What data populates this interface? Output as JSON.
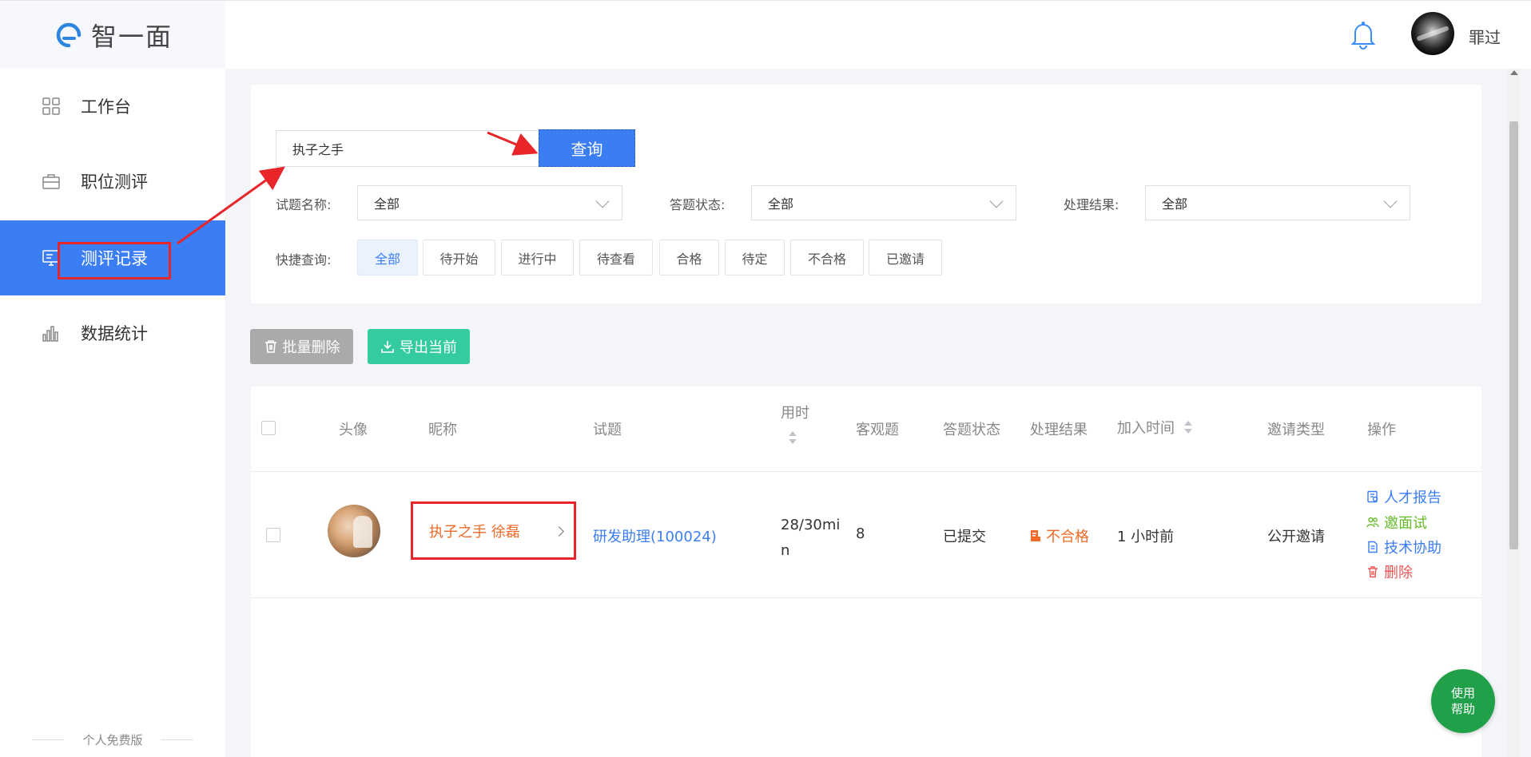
{
  "app": {
    "logo_text": "智一面",
    "username": "罪过"
  },
  "sidebar": {
    "items": [
      {
        "label": "工作台",
        "icon": "grid-icon"
      },
      {
        "label": "职位测评",
        "icon": "briefcase-icon"
      },
      {
        "label": "测评记录",
        "icon": "monitor-icon",
        "active": true
      },
      {
        "label": "数据统计",
        "icon": "bar-chart-icon"
      }
    ],
    "footer": "个人免费版"
  },
  "search": {
    "value": "执子之手",
    "button_label": "查询"
  },
  "filters": {
    "exam_name_label": "试题名称:",
    "exam_name_value": "全部",
    "answer_status_label": "答题状态:",
    "answer_status_value": "全部",
    "result_label": "处理结果:",
    "result_value": "全部",
    "quick_label": "快捷查询:",
    "quick_options": [
      "全部",
      "待开始",
      "进行中",
      "待查看",
      "合格",
      "待定",
      "不合格",
      "已邀请"
    ]
  },
  "actions": {
    "batch_delete": "批量删除",
    "export_current": "导出当前"
  },
  "table": {
    "headers": {
      "avatar": "头像",
      "nickname": "昵称",
      "exam": "试题",
      "duration": "用时",
      "objective": "客观题",
      "answer_status": "答题状态",
      "result": "处理结果",
      "join_time": "加入时间",
      "invite_type": "邀请类型",
      "operations": "操作"
    },
    "rows": [
      {
        "nickname": "执子之手 徐磊",
        "exam": "研发助理(100024)",
        "duration": "28/30min",
        "objective": "8",
        "answer_status": "已提交",
        "result": "不合格",
        "join_time": "1 小时前",
        "invite_type": "公开邀请",
        "ops": [
          "人才报告",
          "邀面试",
          "技术协助",
          "删除"
        ]
      }
    ]
  },
  "help": {
    "label": "使用帮助"
  },
  "colors": {
    "primary": "#3b7ef4",
    "success": "#35cba0",
    "danger": "#e8262a",
    "warning": "#ee6a26",
    "help_green": "#1fa049",
    "invite_green": "#66bb2a",
    "delete_red": "#f15454"
  }
}
